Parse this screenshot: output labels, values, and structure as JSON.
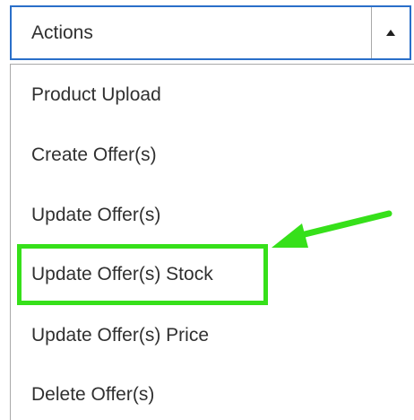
{
  "dropdown": {
    "label": "Actions",
    "toggle_icon": "caret-up-icon"
  },
  "menu": {
    "items": [
      {
        "label": "Product Upload"
      },
      {
        "label": "Create Offer(s)"
      },
      {
        "label": "Update Offer(s)"
      },
      {
        "label": "Update Offer(s) Stock"
      },
      {
        "label": "Update Offer(s) Price"
      },
      {
        "label": "Delete Offer(s)"
      }
    ]
  },
  "annotation": {
    "highlight_color": "#36e01a",
    "icon": "arrow-icon",
    "target": "Update Offer(s) Stock"
  },
  "colors": {
    "select_border": "#2a6fc9",
    "menu_border": "#a9a9a9",
    "text": "#303030"
  }
}
